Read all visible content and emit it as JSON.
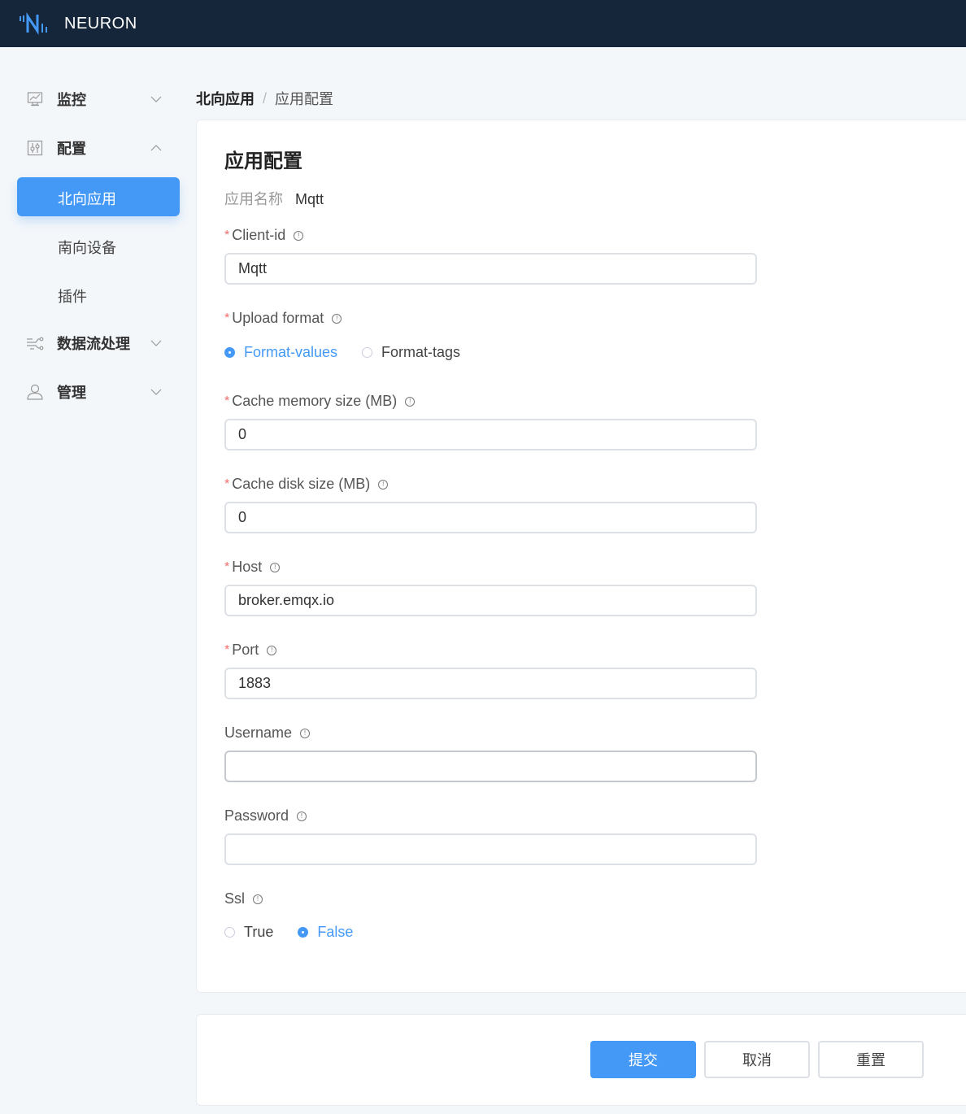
{
  "header": {
    "app_name": "NEURON",
    "logo_icon": "neuron-logo-icon",
    "brand_color": "#4499f7",
    "bar_color": "#15263b"
  },
  "sidebar": {
    "items": [
      {
        "label": "监控",
        "icon": "monitor-chart-icon",
        "expanded": false
      },
      {
        "label": "配置",
        "icon": "sliders-icon",
        "expanded": true,
        "children": [
          {
            "label": "北向应用",
            "active": true
          },
          {
            "label": "南向设备",
            "active": false
          },
          {
            "label": "插件",
            "active": false
          }
        ]
      },
      {
        "label": "数据流处理",
        "icon": "data-flow-icon",
        "expanded": false
      },
      {
        "label": "管理",
        "icon": "user-icon",
        "expanded": false
      }
    ]
  },
  "breadcrumb": {
    "root": "北向应用",
    "separator": "/",
    "current": "应用配置"
  },
  "form": {
    "title": "应用配置",
    "app_name_label": "应用名称",
    "app_name_value": "Mqtt",
    "fields": {
      "client_id": {
        "label": "Client-id",
        "required": true,
        "value": "Mqtt"
      },
      "upload_format": {
        "label": "Upload format",
        "required": true,
        "options": [
          "Format-values",
          "Format-tags"
        ],
        "selected": "Format-values"
      },
      "cache_memory": {
        "label": "Cache memory size (MB)",
        "required": true,
        "value": "0"
      },
      "cache_disk": {
        "label": "Cache disk size (MB)",
        "required": true,
        "value": "0"
      },
      "host": {
        "label": "Host",
        "required": true,
        "value": "broker.emqx.io"
      },
      "port": {
        "label": "Port",
        "required": true,
        "value": "1883"
      },
      "username": {
        "label": "Username",
        "required": false,
        "value": ""
      },
      "password": {
        "label": "Password",
        "required": false,
        "value": ""
      },
      "ssl": {
        "label": "Ssl",
        "required": false,
        "options": [
          "True",
          "False"
        ],
        "selected": "False"
      }
    },
    "required_mark": "*",
    "info_glyph": "!"
  },
  "actions": {
    "submit": "提交",
    "cancel": "取消",
    "reset": "重置"
  }
}
